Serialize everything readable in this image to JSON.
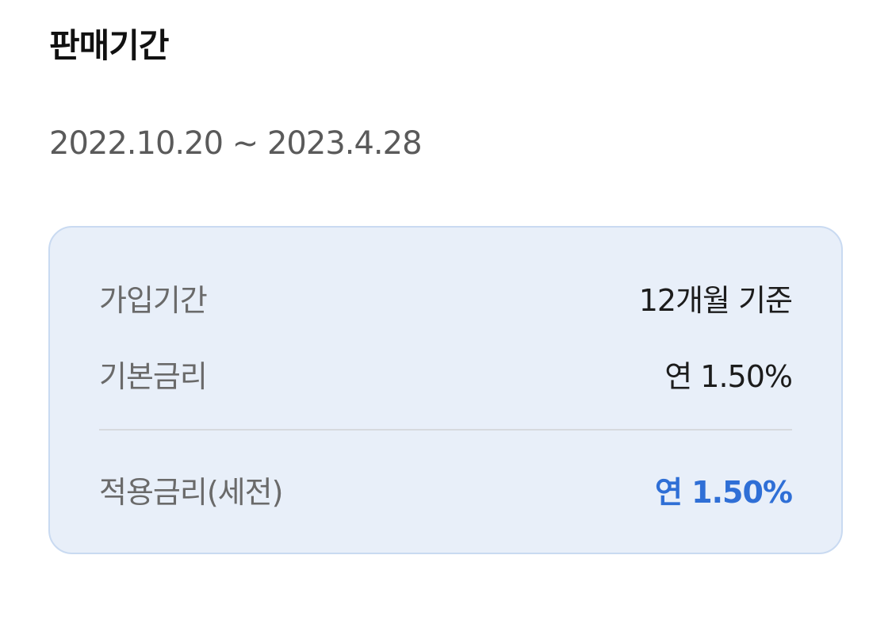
{
  "section": {
    "title": "판매기간",
    "period": "2022.10.20 ~ 2023.4.28"
  },
  "rates": {
    "rows": [
      {
        "label": "가입기간",
        "value": "12개월 기준"
      },
      {
        "label": "기본금리",
        "value": "연 1.50%"
      }
    ],
    "applied": {
      "label": "적용금리(세전)",
      "value": "연 1.50%"
    }
  },
  "colors": {
    "accent": "#2f6fd6",
    "card_background": "#e8eff9",
    "card_border": "#c9daf1"
  }
}
